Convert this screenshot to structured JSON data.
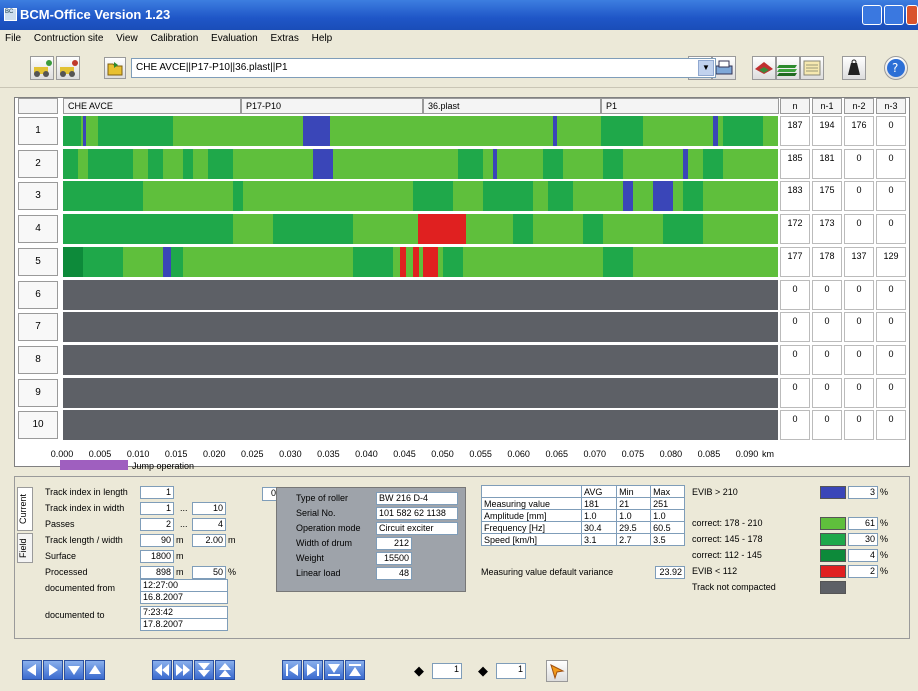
{
  "window": {
    "title": "BCM-Office Version 1.23"
  },
  "menu": [
    "File",
    "Contruction site",
    "View",
    "Calibration",
    "Evaluation",
    "Extras",
    "Help"
  ],
  "toolbar": {
    "path_value": "CHE AVCE||P17-P10||36.plast||P1"
  },
  "grid": {
    "headers": [
      "CHE AVCE",
      "P17-P10",
      "36.plast",
      "P1"
    ],
    "stat_headers": [
      "n",
      "n-1",
      "n-2",
      "n-3"
    ],
    "rows": [
      {
        "label": "1",
        "stats": [
          "187",
          "194",
          "176",
          "0"
        ]
      },
      {
        "label": "2",
        "stats": [
          "185",
          "181",
          "0",
          "0"
        ]
      },
      {
        "label": "3",
        "stats": [
          "183",
          "175",
          "0",
          "0"
        ]
      },
      {
        "label": "4",
        "stats": [
          "172",
          "173",
          "0",
          "0"
        ]
      },
      {
        "label": "5",
        "stats": [
          "177",
          "178",
          "137",
          "129"
        ]
      },
      {
        "label": "6",
        "stats": [
          "0",
          "0",
          "0",
          "0"
        ]
      },
      {
        "label": "7",
        "stats": [
          "0",
          "0",
          "0",
          "0"
        ]
      },
      {
        "label": "8",
        "stats": [
          "0",
          "0",
          "0",
          "0"
        ]
      },
      {
        "label": "9",
        "stats": [
          "0",
          "0",
          "0",
          "0"
        ]
      },
      {
        "label": "10",
        "stats": [
          "0",
          "0",
          "0",
          "0"
        ]
      }
    ],
    "axis_ticks": [
      "0.000",
      "0.005",
      "0.010",
      "0.015",
      "0.020",
      "0.025",
      "0.030",
      "0.035",
      "0.040",
      "0.045",
      "0.050",
      "0.055",
      "0.060",
      "0.065",
      "0.070",
      "0.075",
      "0.080",
      "0.085",
      "0.090"
    ],
    "axis_unit": "km",
    "jump_label": "Jump operation"
  },
  "tabs": [
    "Current",
    "Field"
  ],
  "fields": {
    "track_index_length_label": "Track index in length",
    "track_index_length": "1",
    "track_index_width_label": "Track index in width",
    "track_index_width": "1",
    "track_index_width_max": "10",
    "passes_label": "Passes",
    "passes": "2",
    "passes_max": "4",
    "track_lw_label": "Track length / width",
    "track_length": "90",
    "track_width": "2.00",
    "unit_m": "m",
    "surface_label": "Surface",
    "surface": "1800",
    "processed_label": "Processed",
    "processed": "898",
    "processed_pct": "50",
    "unit_pct": "%",
    "doc_from_label": "documented from",
    "doc_from_time": "12:27:00",
    "doc_from_date": "16.8.2007",
    "doc_to_label": "documented to",
    "doc_to_time": "7:23:42",
    "doc_to_date": "17.8.2007",
    "spinner": "0",
    "ellipsis": "..."
  },
  "roller": [
    {
      "label": "Type of roller",
      "value": "BW 216 D-4"
    },
    {
      "label": "Serial No.",
      "value": "101 582 62 1138"
    },
    {
      "label": "Operation mode",
      "value": "Circuit exciter"
    },
    {
      "label": "Width of drum",
      "value": "212"
    },
    {
      "label": "Weight",
      "value": "15500"
    },
    {
      "label": "Linear load",
      "value": "48"
    }
  ],
  "measure": {
    "headers": [
      "AVG",
      "Min",
      "Max"
    ],
    "rows": [
      {
        "label": "Measuring value",
        "values": [
          "181",
          "21",
          "251"
        ]
      },
      {
        "label": "Amplitude [mm]",
        "values": [
          "1.0",
          "1.0",
          "1.0"
        ]
      },
      {
        "label": "Frequency [Hz]",
        "values": [
          "30.4",
          "29.5",
          "60.5"
        ]
      },
      {
        "label": "Speed [km/h]",
        "values": [
          "3.1",
          "2.7",
          "3.5"
        ]
      }
    ],
    "variance_label": "Measuring value default variance",
    "variance": "23.92"
  },
  "legend": [
    {
      "label": "EVIB > 210",
      "color": "#3a46b8",
      "pct": "3"
    },
    {
      "label": "correct: 178 - 210",
      "color": "#5fbf3c",
      "pct": "61"
    },
    {
      "label": "correct: 145 - 178",
      "color": "#1fa84a",
      "pct": "30"
    },
    {
      "label": "correct: 112 - 145",
      "color": "#0d8a3a",
      "pct": "4"
    },
    {
      "label": "EVIB < 112",
      "color": "#e02020",
      "pct": "2"
    },
    {
      "label": "Track not compacted",
      "color": "#5d6066",
      "pct": ""
    }
  ],
  "nav": {
    "h_value": "1",
    "v_value": "1"
  }
}
